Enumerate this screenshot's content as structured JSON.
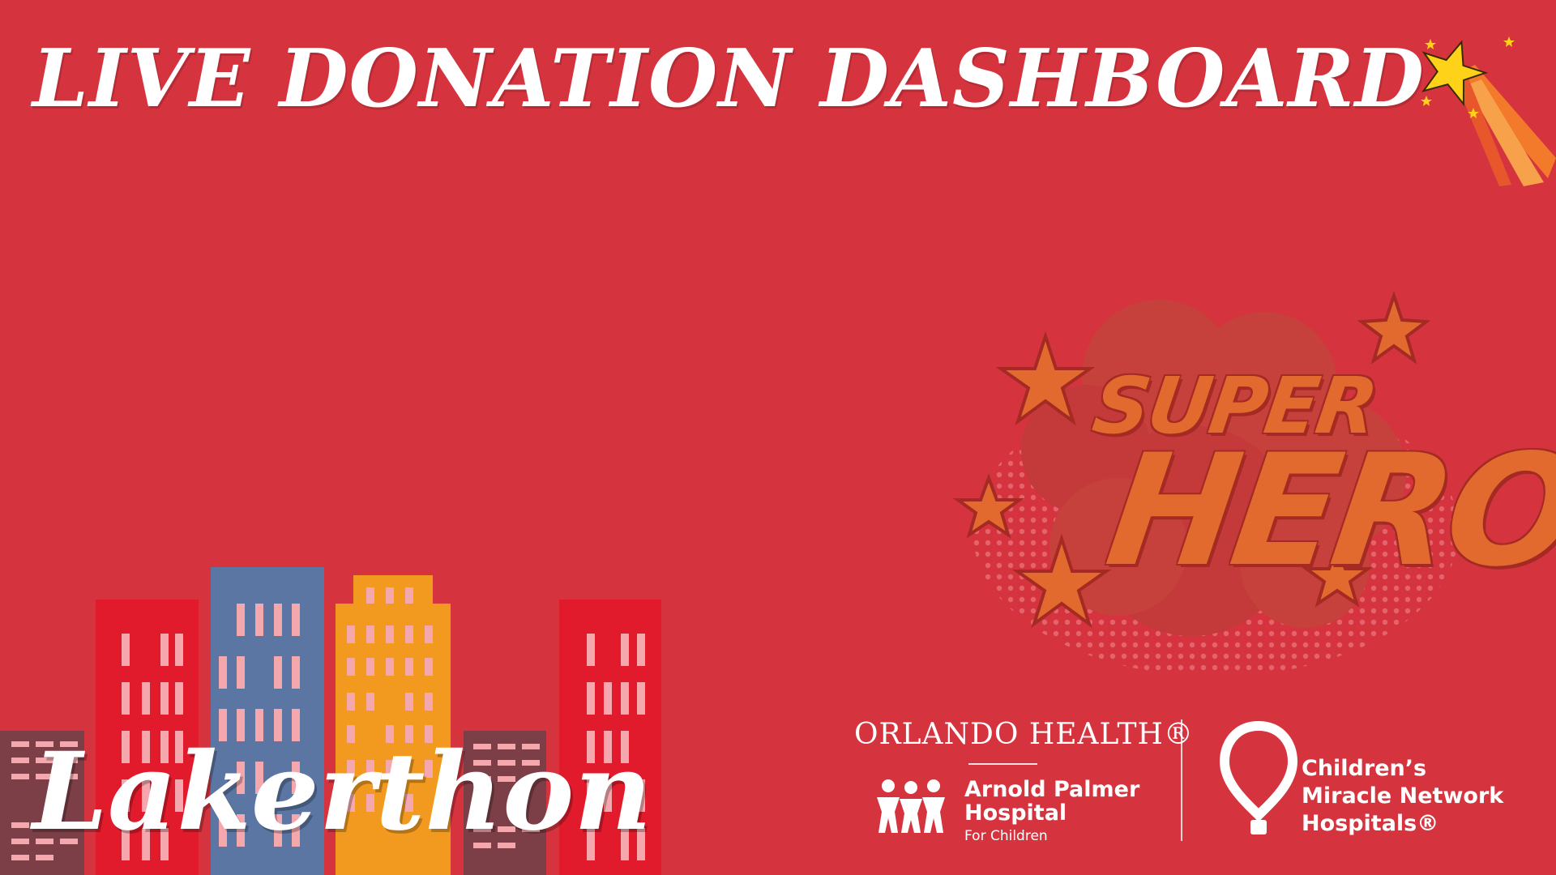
{
  "header": {
    "title": "LIVE DONATION DASHBOARD"
  },
  "badge": {
    "line1": "SUPER",
    "line2": "HERO",
    "icon": "superhero-burst-icon"
  },
  "event": {
    "name": "Lakerthon"
  },
  "sponsors": {
    "orlando_health": {
      "name": "ORLANDO HEALTH®",
      "hospital_line1": "Arnold Palmer",
      "hospital_line2": "Hospital",
      "hospital_line3": "For Children",
      "icon": "children-group-icon"
    },
    "cmn": {
      "line1": "Children’s",
      "line2": "Miracle Network",
      "line3": "Hospitals®",
      "icon": "balloon-icon"
    }
  },
  "colors": {
    "background": "#d5343f",
    "building_red": "#e21b2c",
    "building_blue": "#5b76a3",
    "building_orange": "#f29a1f",
    "building_brown": "#7d3f47",
    "window": "#f4a7ad",
    "star_yellow": "#ffd21a",
    "star_orange": "#f27a2a"
  }
}
